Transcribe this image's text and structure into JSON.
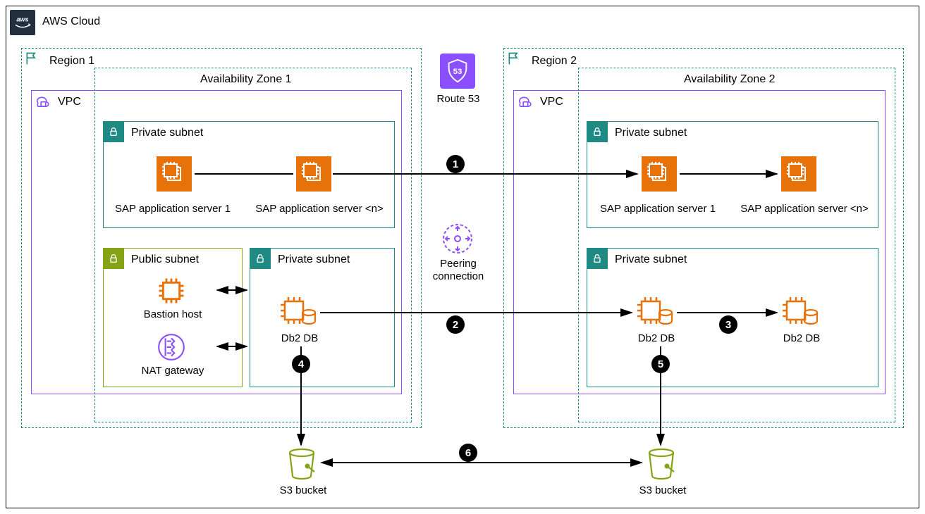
{
  "cloud": {
    "title": "AWS Cloud",
    "logo": "aws"
  },
  "route53": {
    "label": "Route 53",
    "port": "53"
  },
  "peering": {
    "label_line1": "Peering",
    "label_line2": "connection"
  },
  "region1": {
    "title": "Region 1",
    "az": {
      "title": "Availability Zone 1"
    },
    "vpc": {
      "title": "VPC"
    },
    "private_top": {
      "title": "Private subnet",
      "app1": "SAP application server 1",
      "appn": "SAP application server <n>"
    },
    "public": {
      "title": "Public subnet",
      "bastion": "Bastion host",
      "nat": "NAT gateway"
    },
    "private_db": {
      "title": "Private subnet",
      "db": "Db2 DB"
    }
  },
  "region2": {
    "title": "Region 2",
    "az": {
      "title": "Availability Zone 2"
    },
    "vpc": {
      "title": "VPC"
    },
    "private_top": {
      "title": "Private subnet",
      "app1": "SAP application server 1",
      "appn": "SAP application server <n>"
    },
    "private_db": {
      "title": "Private subnet",
      "db1": "Db2 DB",
      "db2": "Db2 DB"
    }
  },
  "s3": {
    "left": "S3 bucket",
    "right": "S3 bucket"
  },
  "markers": {
    "m1": "1",
    "m2": "2",
    "m3": "3",
    "m4": "4",
    "m5": "5",
    "m6": "6"
  }
}
